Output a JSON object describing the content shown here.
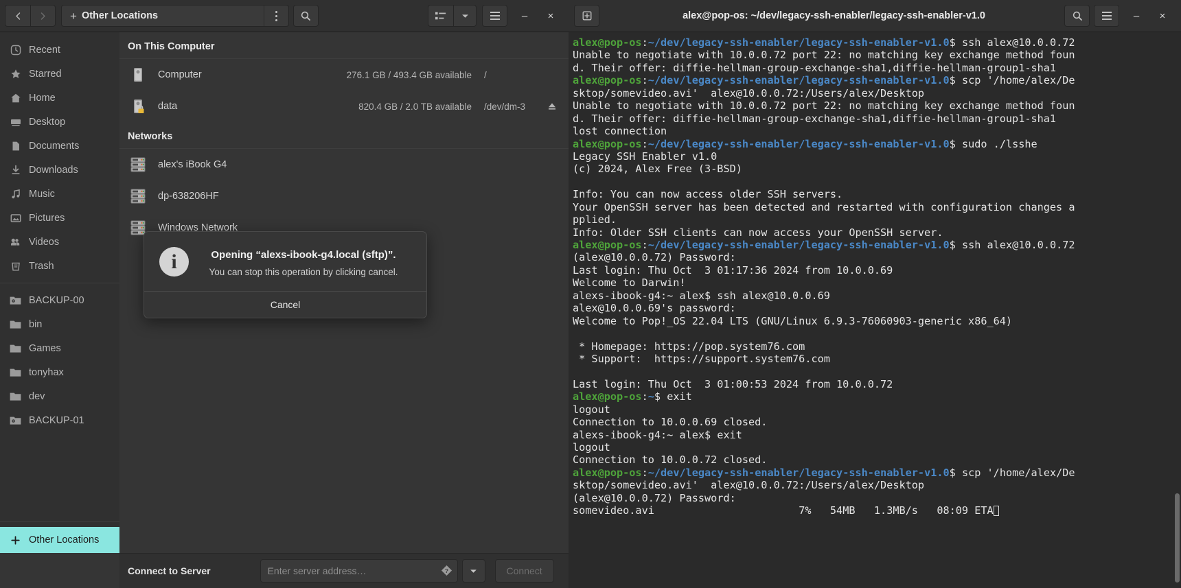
{
  "file_manager": {
    "toolbar": {
      "back_icon": "chevron-left-icon",
      "forward_icon": "chevron-right-icon",
      "path_plus": "+",
      "path_label": "Other Locations",
      "menu_dots_icon": "vertical-dots-icon",
      "search_icon": "search-icon",
      "view_list_icon": "list-view-icon",
      "view_dropdown_icon": "chevron-down-icon",
      "hamburger_icon": "hamburger-menu-icon",
      "minimize_label": "–",
      "close_label": "×"
    },
    "sidebar": {
      "items": [
        {
          "label": "Recent",
          "icon": "clock-icon"
        },
        {
          "label": "Starred",
          "icon": "star-icon"
        },
        {
          "label": "Home",
          "icon": "home-icon"
        },
        {
          "label": "Desktop",
          "icon": "desktop-icon"
        },
        {
          "label": "Documents",
          "icon": "document-icon"
        },
        {
          "label": "Downloads",
          "icon": "download-icon"
        },
        {
          "label": "Music",
          "icon": "music-note-icon"
        },
        {
          "label": "Pictures",
          "icon": "picture-icon"
        },
        {
          "label": "Videos",
          "icon": "video-camera-icon"
        },
        {
          "label": "Trash",
          "icon": "trash-icon"
        }
      ],
      "bookmarks": [
        {
          "label": "BACKUP-00",
          "icon": "folder-removable-icon"
        },
        {
          "label": "bin",
          "icon": "folder-icon"
        },
        {
          "label": "Games",
          "icon": "folder-icon"
        },
        {
          "label": "tonyhax",
          "icon": "folder-icon"
        },
        {
          "label": "dev",
          "icon": "folder-icon"
        },
        {
          "label": "BACKUP-01",
          "icon": "folder-removable-icon"
        }
      ],
      "other_locations": {
        "label": "Other Locations",
        "icon": "plus-icon",
        "selected": true
      },
      "selected_bg": "#8ae6e0"
    },
    "main": {
      "section_computer": "On This Computer",
      "section_networks": "Networks",
      "drives": [
        {
          "name": "Computer",
          "free": "276.1 GB / 493.4 GB available",
          "device": "/",
          "icon": "drive-harddisk-icon",
          "has_eject": false
        },
        {
          "name": "data",
          "free": "820.4 GB / 2.0 TB available",
          "device": "/dev/dm-3",
          "icon": "drive-harddisk-locked-icon",
          "has_eject": true,
          "eject_icon": "eject-icon"
        }
      ],
      "networks": [
        {
          "name": "alex's iBook G4",
          "icon": "network-server-icon"
        },
        {
          "name": "dp-638206HF",
          "icon": "network-server-icon"
        },
        {
          "name": "Windows Network",
          "icon": "network-server-icon"
        }
      ]
    },
    "dialog": {
      "icon": "info-icon",
      "title": "Opening “alexs-ibook-g4.local (sftp)”.",
      "subtitle": "You can stop this operation by clicking cancel.",
      "cancel_label": "Cancel"
    },
    "footer": {
      "label": "Connect to Server",
      "address_value": "",
      "address_placeholder": "Enter server address…",
      "help_icon": "help-diamond-icon",
      "dropdown_icon": "chevron-down-icon",
      "connect_label": "Connect"
    }
  },
  "terminal": {
    "header": {
      "new_tab_icon": "new-window-icon",
      "title": "alex@pop-os: ~/dev/legacy-ssh-enabler/legacy-ssh-enabler-v1.0",
      "search_icon": "search-icon",
      "hamburger_icon": "hamburger-menu-icon",
      "minimize_label": "–",
      "close_label": "×"
    },
    "prompt": {
      "user_host": "alex@pop-os",
      "colon": ":",
      "path": "~/dev/legacy-ssh-enabler/legacy-ssh-enabler-v1.0",
      "sigil": "$",
      "user_color": "#4ea33a",
      "path_color": "#4a88c7"
    },
    "lines": [
      {
        "type": "prompt",
        "cmd": " ssh alex@10.0.0.72"
      },
      {
        "type": "out",
        "text": "Unable to negotiate with 10.0.0.72 port 22: no matching key exchange method foun"
      },
      {
        "type": "out",
        "text": "d. Their offer: diffie-hellman-group-exchange-sha1,diffie-hellman-group1-sha1"
      },
      {
        "type": "prompt",
        "cmd": " scp '/home/alex/De"
      },
      {
        "type": "out",
        "text": "sktop/somevideo.avi'  alex@10.0.0.72:/Users/alex/Desktop"
      },
      {
        "type": "out",
        "text": "Unable to negotiate with 10.0.0.72 port 22: no matching key exchange method foun"
      },
      {
        "type": "out",
        "text": "d. Their offer: diffie-hellman-group-exchange-sha1,diffie-hellman-group1-sha1"
      },
      {
        "type": "out",
        "text": "lost connection"
      },
      {
        "type": "prompt",
        "cmd": " sudo ./lsshe"
      },
      {
        "type": "out",
        "text": "Legacy SSH Enabler v1.0"
      },
      {
        "type": "out",
        "text": "(c) 2024, Alex Free (3-BSD)"
      },
      {
        "type": "out",
        "text": ""
      },
      {
        "type": "out",
        "text": "Info: You can now access older SSH servers."
      },
      {
        "type": "out",
        "text": "Your OpenSSH server has been detected and restarted with configuration changes a"
      },
      {
        "type": "out",
        "text": "pplied."
      },
      {
        "type": "out",
        "text": "Info: Older SSH clients can now access your OpenSSH server."
      },
      {
        "type": "prompt",
        "cmd": " ssh alex@10.0.0.72"
      },
      {
        "type": "out",
        "text": "(alex@10.0.0.72) Password:"
      },
      {
        "type": "out",
        "text": "Last login: Thu Oct  3 01:17:36 2024 from 10.0.0.69"
      },
      {
        "type": "out",
        "text": "Welcome to Darwin!"
      },
      {
        "type": "out",
        "text": "alexs-ibook-g4:~ alex$ ssh alex@10.0.0.69"
      },
      {
        "type": "out",
        "text": "alex@10.0.0.69's password:"
      },
      {
        "type": "out",
        "text": "Welcome to Pop!_OS 22.04 LTS (GNU/Linux 6.9.3-76060903-generic x86_64)"
      },
      {
        "type": "out",
        "text": ""
      },
      {
        "type": "out",
        "text": " * Homepage: https://pop.system76.com"
      },
      {
        "type": "out",
        "text": " * Support:  https://support.system76.com"
      },
      {
        "type": "out",
        "text": ""
      },
      {
        "type": "out",
        "text": "Last login: Thu Oct  3 01:00:53 2024 from 10.0.0.72"
      },
      {
        "type": "prompt_short",
        "user_host": "alex@pop-os",
        "path": "~",
        "cmd": " exit"
      },
      {
        "type": "out",
        "text": "logout"
      },
      {
        "type": "out",
        "text": "Connection to 10.0.0.69 closed."
      },
      {
        "type": "out",
        "text": "alexs-ibook-g4:~ alex$ exit"
      },
      {
        "type": "out",
        "text": "logout"
      },
      {
        "type": "out",
        "text": "Connection to 10.0.0.72 closed."
      },
      {
        "type": "prompt",
        "cmd": " scp '/home/alex/De"
      },
      {
        "type": "out",
        "text": "sktop/somevideo.avi'  alex@10.0.0.72:/Users/alex/Desktop"
      },
      {
        "type": "out",
        "text": "(alex@10.0.0.72) Password:"
      },
      {
        "type": "progress",
        "name": "somevideo.avi",
        "percent": "7%",
        "transferred": "54MB",
        "rate": "1.3MB/s",
        "eta": "08:09 ETA"
      }
    ],
    "scrollbar": true
  }
}
